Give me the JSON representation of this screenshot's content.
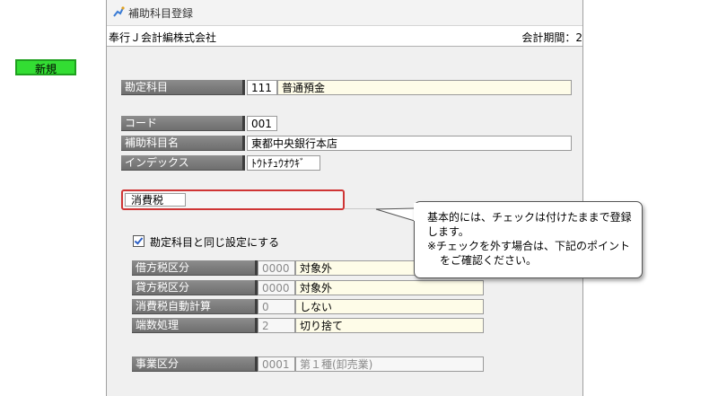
{
  "window": {
    "title": "補助科目登録",
    "company": "奉行Ｊ会計編株式会社",
    "period": "会計期間：2"
  },
  "form": {
    "new_badge": "新規",
    "account": {
      "label": "勘定科目",
      "code": "111",
      "name": "普通預金"
    },
    "code": {
      "label": "コード",
      "value": "001"
    },
    "sub_name": {
      "label": "補助科目名",
      "value": "東都中央銀行本店"
    },
    "index": {
      "label": "インデックス",
      "value": "ﾄｳﾄﾁｭｳｵｳｷﾞ"
    }
  },
  "tax": {
    "section_label": "消費税",
    "same_setting": {
      "label": "勘定科目と同じ設定にする",
      "checked": true
    },
    "rows": [
      {
        "label": "借方税区分",
        "code": "0000",
        "value": "対象外"
      },
      {
        "label": "貸方税区分",
        "code": "0000",
        "value": "対象外"
      },
      {
        "label": "消費税自動計算",
        "code": "0",
        "value": "しない"
      },
      {
        "label": "端数処理",
        "code": "2",
        "value": "切り捨て"
      }
    ],
    "business": {
      "label": "事業区分",
      "code": "0001",
      "value": "第１種(卸売業)"
    }
  },
  "callout": {
    "line1": "基本的には、チェックは付けたままで登録",
    "line2": "します。",
    "line3": "※チェックを外す場合は、下記のポイント",
    "line4": "をご確認ください。"
  },
  "colors": {
    "highlight": "#cf3535",
    "new_badge": "#33dd33",
    "label_bg": "#7d7d7d"
  }
}
